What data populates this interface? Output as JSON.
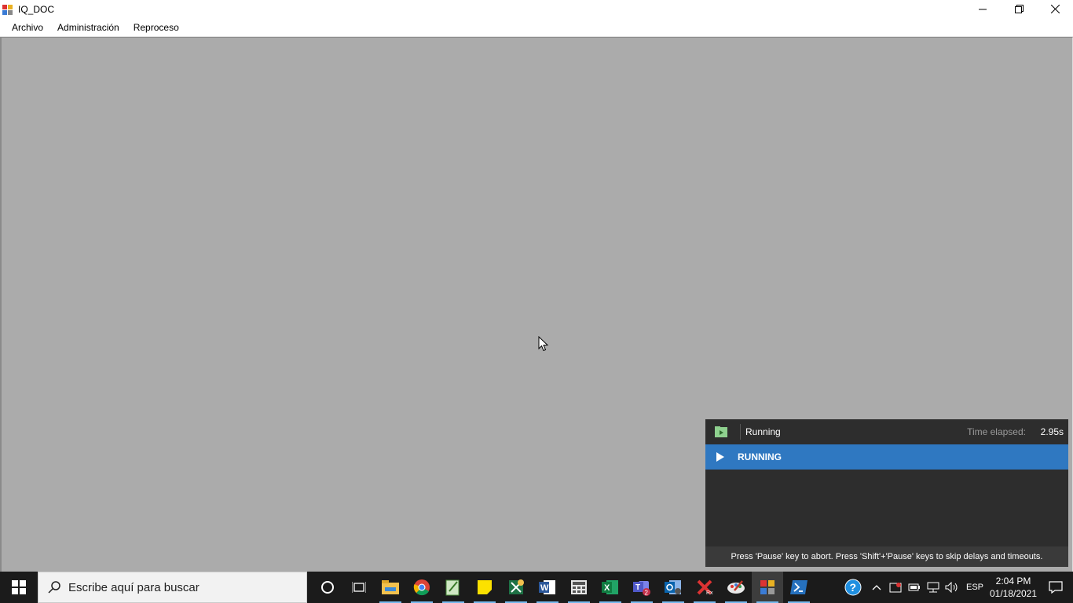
{
  "window": {
    "title": "IQ_DOC",
    "controls": {
      "minimize_icon": "minimize-icon",
      "restore_icon": "restore-icon",
      "close_icon": "close-icon"
    }
  },
  "menubar": {
    "items": [
      {
        "label": "Archivo"
      },
      {
        "label": "Administración"
      },
      {
        "label": "Reproceso"
      }
    ]
  },
  "run_panel": {
    "status": "Running",
    "elapsed_label": "Time elapsed:",
    "elapsed_value": "2.95s",
    "row_label": "RUNNING",
    "footer": "Press 'Pause' key to abort. Press 'Shift'+'Pause' keys to skip delays and timeouts.",
    "colors": {
      "panel_bg": "#2d2d2d",
      "row_bg": "#2f78c1"
    }
  },
  "taskbar": {
    "search_placeholder": "Escribe aquí para buscar",
    "pinned": [
      {
        "name": "cortana-icon"
      },
      {
        "name": "task-view-icon"
      },
      {
        "name": "file-explorer-icon"
      },
      {
        "name": "chrome-icon"
      },
      {
        "name": "notepad-plus-icon"
      },
      {
        "name": "sticky-notes-icon"
      },
      {
        "name": "excel-sync-icon"
      },
      {
        "name": "word-icon"
      },
      {
        "name": "calculator-icon"
      },
      {
        "name": "excel-icon"
      },
      {
        "name": "teams-icon",
        "badge": "2"
      },
      {
        "name": "outlook-icon"
      },
      {
        "name": "tool-rx-icon"
      },
      {
        "name": "paint-icon"
      },
      {
        "name": "iq-doc-icon"
      },
      {
        "name": "powershell-icon"
      }
    ],
    "tray": {
      "language": "ESP",
      "time": "2:04 PM",
      "date": "01/18/2021"
    }
  }
}
